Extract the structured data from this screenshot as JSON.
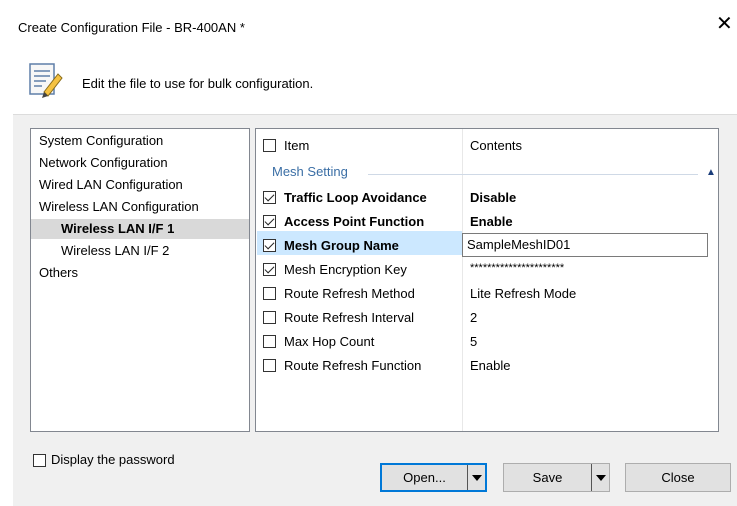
{
  "window": {
    "title": "Create Configuration File - BR-400AN *",
    "close_glyph": "✕",
    "description": "Edit the file to use for bulk configuration.",
    "header_icon": "edit-document-icon"
  },
  "tree": {
    "items": [
      {
        "label": "System Configuration",
        "level": 0,
        "selected": false
      },
      {
        "label": "Network Configuration",
        "level": 0,
        "selected": false
      },
      {
        "label": "Wired LAN Configuration",
        "level": 0,
        "selected": false
      },
      {
        "label": "Wireless LAN Configuration",
        "level": 0,
        "selected": false
      },
      {
        "label": "Wireless LAN I/F 1",
        "level": 1,
        "selected": true
      },
      {
        "label": "Wireless LAN I/F 2",
        "level": 1,
        "selected": false
      },
      {
        "label": "Others",
        "level": 0,
        "selected": false
      }
    ]
  },
  "grid": {
    "header": {
      "item": "Item",
      "contents": "Contents"
    },
    "group": "Mesh Setting",
    "rows": [
      {
        "item": "Traffic Loop Avoidance",
        "value": "Disable",
        "checked": true,
        "bold": true
      },
      {
        "item": "Access Point Function",
        "value": "Enable",
        "checked": true,
        "bold": true
      },
      {
        "item": "Mesh Group Name",
        "value": "SampleMeshID01",
        "checked": true,
        "bold": true
      },
      {
        "item": "Mesh Encryption Key",
        "value": "**********************",
        "checked": true,
        "bold": false
      },
      {
        "item": "Route Refresh Method",
        "value": "Lite Refresh Mode",
        "checked": false,
        "bold": false
      },
      {
        "item": "Route Refresh Interval",
        "value": "2",
        "checked": false,
        "bold": false
      },
      {
        "item": "Max Hop Count",
        "value": "5",
        "checked": false,
        "bold": false
      },
      {
        "item": "Route Refresh Function",
        "value": "Enable",
        "checked": false,
        "bold": false
      }
    ]
  },
  "footer": {
    "display_password": "Display the password",
    "open_label": "Open...",
    "save_label": "Save",
    "close_label": "Close"
  },
  "colors": {
    "accent": "#0078d7",
    "group_text": "#3a6ea5",
    "selection": "#cce8ff"
  }
}
